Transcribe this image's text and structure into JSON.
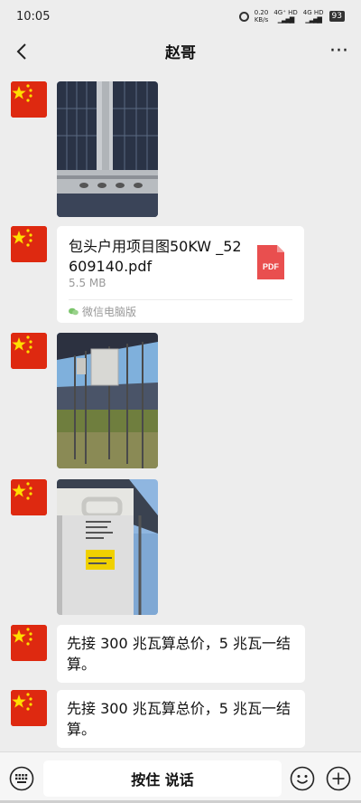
{
  "status_bar": {
    "time": "10:05",
    "net_speed_value": "0.20",
    "net_speed_unit": "KB/s",
    "signal1": "4G⁺ HD",
    "signal2": "4G HD",
    "battery": "93"
  },
  "nav": {
    "title": "赵哥",
    "more": "···"
  },
  "colors": {
    "background": "#ededed",
    "bubble": "#ffffff",
    "avatar_red": "#de2910",
    "star_yellow": "#ffde00",
    "pdf_red": "#e94f4f"
  },
  "messages": [
    {
      "type": "image",
      "description": "solar-panel-mounting-rail-photo"
    },
    {
      "type": "file",
      "file_name": "包头户用项目图50KW _52609140.pdf",
      "file_size": "5.5 MB",
      "file_badge": "PDF",
      "source": "微信电脑版"
    },
    {
      "type": "image",
      "description": "inverter-on-rack-under-panels-photo"
    },
    {
      "type": "image",
      "description": "inverter-label-closeup-photo"
    },
    {
      "type": "text",
      "text": "先接 300 兆瓦算总价，5 兆瓦一结算。"
    },
    {
      "type": "text",
      "text": "先接 300 兆瓦算总价，5 兆瓦一结算。"
    }
  ],
  "input_bar": {
    "hold_to_talk": "按住 说话",
    "icons": [
      "keyboard-icon",
      "emoji-icon",
      "plus-icon"
    ]
  }
}
